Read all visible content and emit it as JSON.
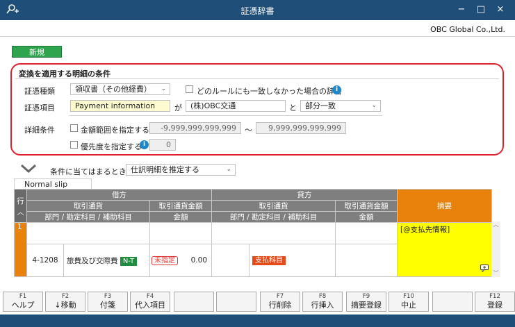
{
  "window": {
    "title": "証憑辞書",
    "minimize": "−",
    "maximize": "□",
    "close": "×"
  },
  "company": "OBC Global Co.,Ltd.",
  "new_button": "新規",
  "conditions": {
    "heading": "変換を適用する明細の条件",
    "doc_type_label": "証憑種類",
    "doc_type_value": "領収書（その他経費）",
    "no_match_label": "どのルールにも一致しなかった場合の辞書",
    "doc_item_label": "証憑項目",
    "doc_item_value": "Payment information",
    "ga": "が",
    "match_text": "(株)OBC交通",
    "to": "と",
    "match_mode": "部分一致",
    "detail_label": "詳細条件",
    "amount_range_label": "金額範囲を指定する",
    "amount_min": "-9,999,999,999,999",
    "tilde": "～",
    "amount_max": "9,999,999,999,999",
    "priority_label": "優先度を指定する",
    "priority_value": "0"
  },
  "rule": {
    "when_label": "条件に当てはまるとき",
    "action": "仕訳明細を推定する"
  },
  "tab": "Normal slip",
  "grid": {
    "row_header": "行",
    "debit": "借方",
    "credit": "貸方",
    "txn_currency": "取引通貨",
    "txn_currency_amount": "取引通貨金額",
    "dept_account": "部門 / 勘定科目 / 補助科目",
    "amount": "金額",
    "summary": "摘要",
    "row_number": "1",
    "debit_code": "4-1208",
    "debit_account": "旅費及び交際費",
    "tax_tag": "N-T",
    "unspecified_tag": "未指定",
    "debit_amount": "0.00",
    "credit_tag": "支払科目",
    "summary_text": "[@支払先情報]"
  },
  "fkeys": [
    {
      "num": "F1",
      "label": "ヘルプ"
    },
    {
      "num": "F2",
      "label": "↓移動"
    },
    {
      "num": "F3",
      "label": "付箋"
    },
    {
      "num": "F4",
      "label": "代入項目"
    },
    {
      "num": "",
      "label": ""
    },
    {
      "num": "",
      "label": ""
    },
    {
      "num": "F7",
      "label": "行削除"
    },
    {
      "num": "F8",
      "label": "行挿入"
    },
    {
      "num": "F9",
      "label": "摘要登録"
    },
    {
      "num": "F10",
      "label": "中止"
    },
    {
      "num": "",
      "label": ""
    },
    {
      "num": "F12",
      "label": "登録"
    }
  ]
}
